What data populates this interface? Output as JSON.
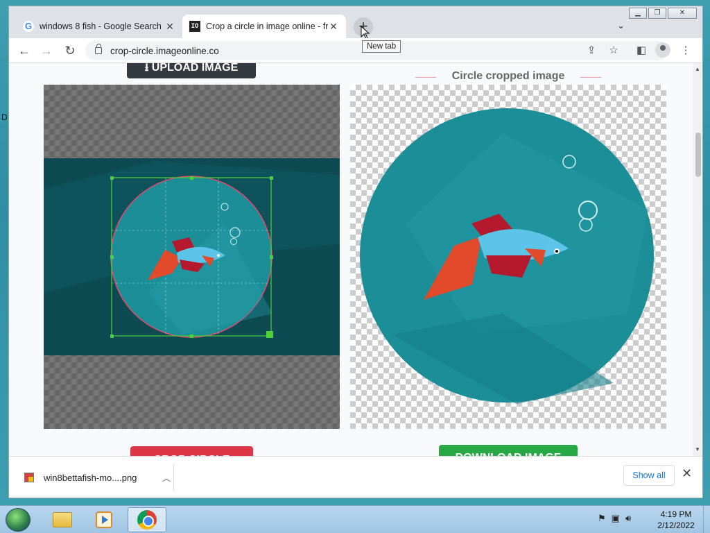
{
  "desktop": {
    "edge_letter": "D"
  },
  "browser": {
    "tabs": [
      {
        "title": "windows 8 fish - Google Search",
        "close": "✕"
      },
      {
        "title": "Crop a circle in image online - fre",
        "favicon_text": "IO",
        "close": "✕"
      }
    ],
    "new_tab_symbol": "+",
    "new_tab_tooltip": "New tab",
    "url": "crop-circle.imageonline.co"
  },
  "page": {
    "upload_button": "UPLOAD IMAGE",
    "preview_title": "Circle cropped image",
    "crop_button": "CROP CIRCLE",
    "download_button": "DOWNLOAD IMAGE"
  },
  "download_bar": {
    "filename": "win8bettafish-mo....png",
    "show_all": "Show all"
  },
  "taskbar": {
    "time": "4:19 PM",
    "date": "2/12/2022"
  },
  "colors": {
    "fish_blue": "#5bc4e8",
    "fish_red": "#b5192d",
    "fish_orange": "#e24a2c",
    "water": "#1b8e98",
    "crop_handle": "#4cd137",
    "crop_circle_outline": "#e8486c",
    "upload_btn": "#343a40",
    "crop_btn": "#dc3545",
    "download_btn": "#28a745"
  }
}
